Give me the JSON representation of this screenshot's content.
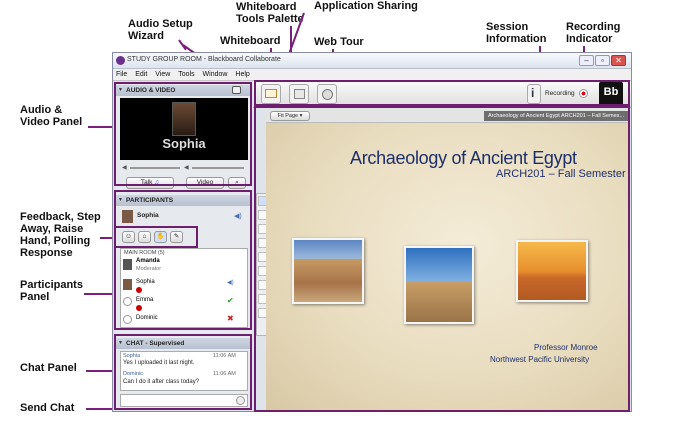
{
  "callouts": {
    "audio_setup": "Audio Setup Wizard",
    "whiteboard_tools": "Whiteboard Tools Palette",
    "app_sharing": "Application Sharing",
    "whiteboard": "Whiteboard",
    "web_tour": "Web Tour",
    "session_info": "Session Information",
    "recording": "Recording Indicator",
    "audio_video": "Audio & Video Panel",
    "feedback": "Feedback, Step Away, Raise Hand, Polling Response",
    "participants": "Participants Panel",
    "chat": "Chat Panel",
    "send_chat": "Send Chat"
  },
  "window": {
    "title": "STUDY GROUP ROOM - Blackboard Collaborate",
    "menu": [
      "File",
      "Edit",
      "View",
      "Tools",
      "Window",
      "Help"
    ],
    "recording_label": "Recording",
    "brand": "Bb"
  },
  "audio_video": {
    "header": "AUDIO & VIDEO",
    "speaker_name": "Sophia",
    "talk_label": "Talk",
    "video_label": "Video"
  },
  "participants": {
    "header": "PARTICIPANTS",
    "me": "Sophia",
    "room_label": "MAIN ROOM (5)",
    "list": [
      {
        "name": "Amanda",
        "role": "Moderator"
      },
      {
        "name": "Sophia",
        "role": ""
      },
      {
        "name": "Emma",
        "role": ""
      },
      {
        "name": "Dominic",
        "role": ""
      }
    ]
  },
  "chat": {
    "header": "CHAT - Supervised",
    "messages": [
      {
        "from": "Sophia",
        "time": "11:06 AM",
        "text": "Yes I uploaded it last night."
      },
      {
        "from": "Dominic",
        "time": "11:06 AM",
        "text": "Can I do it after class today?"
      }
    ]
  },
  "content": {
    "fit_page": "Fit Page",
    "file_tab": "Archaeology of Ancient Egypt ARCH201 – Fall Semes...",
    "slide_title": "Archaeology of Ancient Egypt",
    "slide_subtitle": "ARCH201 – Fall Semester",
    "professor": "Professor Monroe",
    "university": "Northwest Pacific University"
  },
  "colors": {
    "accent": "#6e1e6e",
    "title_blue": "#1d2f6b"
  }
}
